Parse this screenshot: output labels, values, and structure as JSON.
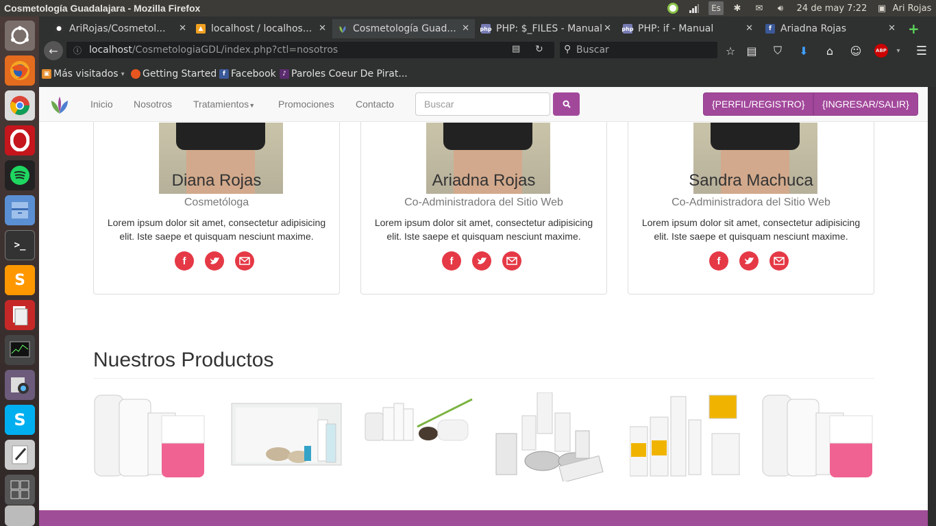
{
  "os": {
    "window_title": "Cosmetología Guadalajara - Mozilla Firefox",
    "keyboard": "Es",
    "datetime": "24 de may  7:22",
    "user": "Ari Rojas"
  },
  "tabs": [
    {
      "label": "AriRojas/Cosmetol...",
      "icon": "github-icon"
    },
    {
      "label": "localhost / localhos...",
      "icon": "phpmyadmin-icon"
    },
    {
      "label": "Cosmetología Guad...",
      "icon": "leaf-icon"
    },
    {
      "label": "PHP: $_FILES - Manual",
      "icon": "php-icon"
    },
    {
      "label": "PHP: if - Manual",
      "icon": "php-icon"
    },
    {
      "label": "Ariadna Rojas",
      "icon": "facebook-icon"
    }
  ],
  "url": {
    "host": "localhost",
    "path": "/CosmetologiaGDL/index.php?ctl=nosotros"
  },
  "browser_search": {
    "placeholder": "Buscar"
  },
  "bookmarks": [
    {
      "label": "Más visitados",
      "icon": "folder-icon"
    },
    {
      "label": "Getting Started",
      "icon": "firefox-icon"
    },
    {
      "label": "Facebook",
      "icon": "facebook-icon"
    },
    {
      "label": "Paroles Coeur De Pirat...",
      "icon": "music-icon"
    }
  ],
  "site_nav": {
    "items": [
      "Inicio",
      "Nosotros",
      "Tratamientos",
      "Promociones",
      "Contacto"
    ],
    "search_placeholder": "Buscar",
    "profile_btn": "{PERFIL/REGISTRO}",
    "login_btn": "{INGRESAR/SALIR}"
  },
  "team": [
    {
      "name": "Diana Rojas",
      "role": "Cosmetóloga",
      "desc": "Lorem ipsum dolor sit amet, consectetur adipisicing elit. Iste saepe et quisquam nesciunt maxime."
    },
    {
      "name": "Ariadna Rojas",
      "role": "Co-Administradora del Sitio Web",
      "desc": "Lorem ipsum dolor sit amet, consectetur adipisicing elit. Iste saepe et quisquam nesciunt maxime."
    },
    {
      "name": "Sandra Machuca",
      "role": "Co-Administradora del Sitio Web",
      "desc": "Lorem ipsum dolor sit amet, consectetur adipisicing elit. Iste saepe et quisquam nesciunt maxime."
    }
  ],
  "products": {
    "title": "Nuestros Productos"
  },
  "colors": {
    "accent": "#a2489b",
    "social": "#e53946"
  }
}
